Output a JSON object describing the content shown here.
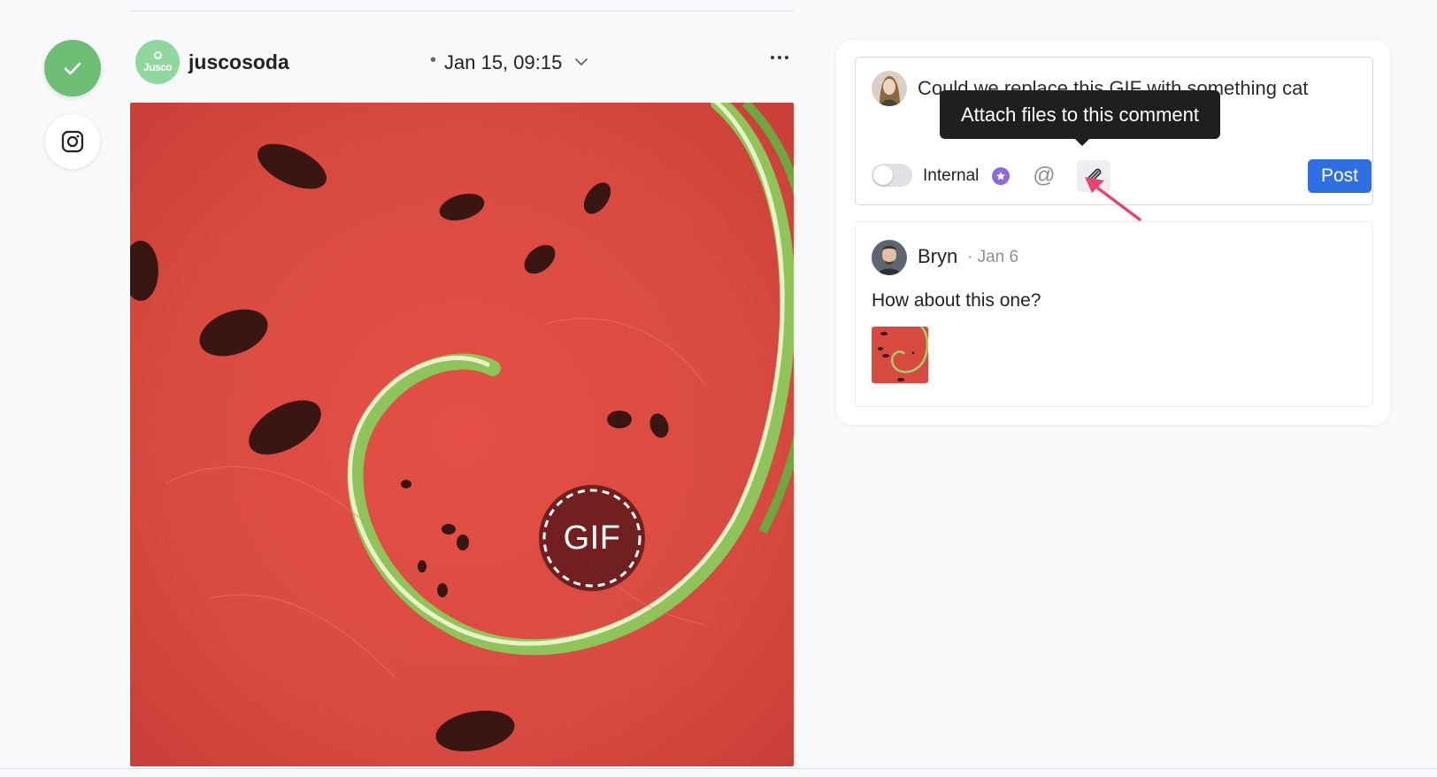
{
  "post": {
    "account_name": "juscosoda",
    "brand_avatar_text": "Jusco",
    "separator": "•",
    "date": "Jan 15, 09:15",
    "media_badge": "GIF",
    "status": "approved",
    "platform": "instagram-icon"
  },
  "composer": {
    "text": "Could we replace this GIF with something cat",
    "internal_label": "Internal",
    "internal_enabled": false,
    "post_label": "Post",
    "tooltip": "Attach files to this comment",
    "mention_symbol": "@"
  },
  "comments": [
    {
      "author": "Bryn",
      "date": "· Jan 6",
      "text": "How about this one?"
    }
  ],
  "colors": {
    "accent_blue": "#2f6fe4",
    "status_green": "#6dbd74",
    "brand_green": "#8fd79e",
    "pro_purple": "#8b6bd9",
    "pointer_pink": "#e8456c",
    "watermelon_red": "#d84040"
  }
}
